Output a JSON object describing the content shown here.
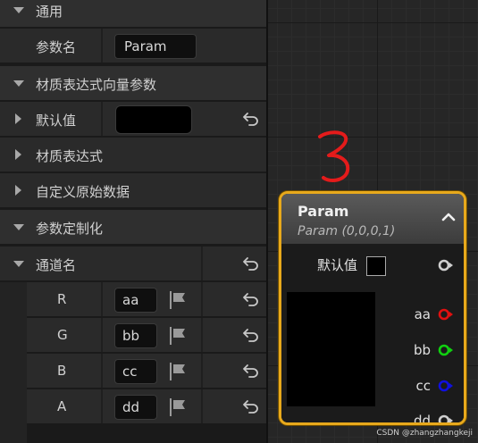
{
  "details": {
    "general": {
      "label": "通用"
    },
    "param_name": {
      "label": "参数名",
      "value": "Param"
    },
    "vector_param": {
      "label": "材质表达式向量参数"
    },
    "default_value": {
      "label": "默认值"
    },
    "material_expression": {
      "label": "材质表达式"
    },
    "custom_primitive": {
      "label": "自定义原始数据"
    },
    "param_custom": {
      "label": "参数定制化"
    },
    "channel_names": {
      "label": "通道名",
      "rows": [
        {
          "name": "R",
          "value": "aa"
        },
        {
          "name": "G",
          "value": "bb"
        },
        {
          "name": "B",
          "value": "cc"
        },
        {
          "name": "A",
          "value": "dd"
        }
      ]
    }
  },
  "annotation": {
    "text": "3"
  },
  "node": {
    "title": "Param",
    "subtitle": "Param (0,0,0,1)",
    "default_label": "默认值",
    "outputs": [
      {
        "label": "",
        "color": "#cfcfcf"
      },
      {
        "label": "aa",
        "color": "#e01010"
      },
      {
        "label": "bb",
        "color": "#10d010"
      },
      {
        "label": "cc",
        "color": "#1010e0"
      },
      {
        "label": "dd",
        "color": "#cfcfcf"
      }
    ],
    "accent": "#e8a91c"
  },
  "watermark": "CSDN @zhangzhangkeji"
}
